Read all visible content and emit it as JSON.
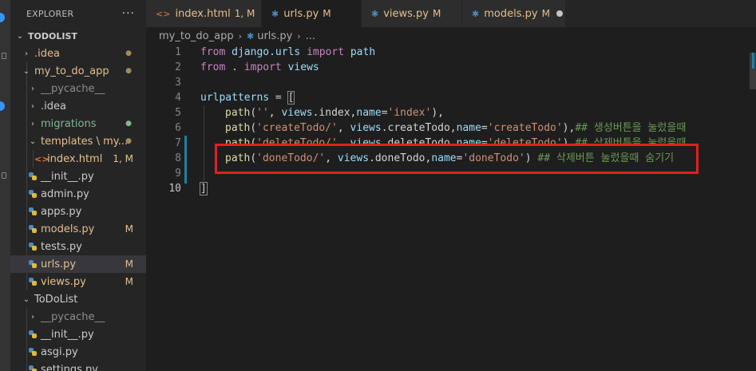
{
  "sidebar": {
    "title": "EXPLORER",
    "more": "···",
    "project": "TODOLIST",
    "items": [
      {
        "label": ".idea",
        "chev": "›",
        "color": "yellow",
        "badge": "●"
      },
      {
        "label": "my_to_do_app",
        "chev": "⌄",
        "color": "yellow",
        "badge": "●"
      },
      {
        "label": "__pycache__",
        "chev": "›",
        "color": "grey",
        "badge": ""
      },
      {
        "label": ".idea",
        "chev": "›",
        "color": "default",
        "badge": ""
      },
      {
        "label": "migrations",
        "chev": "›",
        "color": "green",
        "badge": "●"
      },
      {
        "label": "templates \\ my...",
        "chev": "⌄",
        "color": "yellow",
        "badge": "●"
      },
      {
        "label": "index.html",
        "chev": "",
        "color": "yellow",
        "badge": "1, M"
      },
      {
        "label": "__init__.py",
        "chev": "",
        "color": "default",
        "badge": ""
      },
      {
        "label": "admin.py",
        "chev": "",
        "color": "default",
        "badge": ""
      },
      {
        "label": "apps.py",
        "chev": "",
        "color": "default",
        "badge": ""
      },
      {
        "label": "models.py",
        "chev": "",
        "color": "yellow",
        "badge": "M"
      },
      {
        "label": "tests.py",
        "chev": "",
        "color": "default",
        "badge": ""
      },
      {
        "label": "urls.py",
        "chev": "",
        "color": "yellow",
        "badge": "M"
      },
      {
        "label": "views.py",
        "chev": "",
        "color": "yellow",
        "badge": "M"
      },
      {
        "label": "ToDoList",
        "chev": "⌄",
        "color": "default",
        "badge": ""
      },
      {
        "label": "__pycache__",
        "chev": "›",
        "color": "grey",
        "badge": ""
      },
      {
        "label": "__init__.py",
        "chev": "",
        "color": "default",
        "badge": ""
      },
      {
        "label": "asgi.py",
        "chev": "",
        "color": "default",
        "badge": ""
      },
      {
        "label": "settings.py",
        "chev": "",
        "color": "default",
        "badge": ""
      }
    ]
  },
  "tabs": [
    {
      "label": "index.html",
      "mod": "1, M",
      "icon": "html-icon"
    },
    {
      "label": "urls.py",
      "mod": "M",
      "icon": "python-icon"
    },
    {
      "label": "views.py",
      "mod": "M",
      "icon": "python-icon"
    },
    {
      "label": "models.py",
      "mod": "M",
      "icon": "python-icon"
    }
  ],
  "breadcrumb": {
    "folder": "my_to_do_app",
    "file": "urls.py",
    "more": "..."
  },
  "editor": {
    "line_numbers": [
      "1",
      "2",
      "3",
      "4",
      "5",
      "6",
      "7",
      "8",
      "9",
      "10"
    ],
    "line1": {
      "a": "from",
      "b": " django.urls ",
      "c": "import",
      "d": " path"
    },
    "line2": {
      "a": "from",
      "b": " . ",
      "c": "import",
      "d": " views"
    },
    "line4": {
      "a": "urlpatterns",
      "b": " = ",
      "c": "["
    },
    "line5": {
      "a": "path",
      "b": "(",
      "c": "''",
      "d": ", ",
      "e": "views",
      "f": ".index,",
      "g": "name",
      "h": "=",
      "i": "'index'",
      "j": "),"
    },
    "line6": {
      "a": "path",
      "b": "(",
      "c": "'createTodo/'",
      "d": ", ",
      "e": "views",
      "f": ".createTodo,",
      "g": "name",
      "h": "=",
      "i": "'createTodo'",
      "j": "),",
      "k": "## 생성버튼을 눌렀을때"
    },
    "line7": {
      "a": "path",
      "b": "(",
      "c": "'deleteTodo/'",
      "d": ", ",
      "e": "views",
      "f": ".deleteTodo,",
      "g": "name",
      "h": "=",
      "i": "'deleteTodo'",
      "j": "),",
      "k": "## 삭제버튼을 눌렀을때"
    },
    "line8": {
      "a": "path",
      "b": "(",
      "c": "'doneTodo/'",
      "d": ", ",
      "e": "views",
      "f": ".doneTodo,",
      "g": "name",
      "h": "=",
      "i": "'doneTodo'",
      "j": ")",
      "k": " ## 삭제버튼 눌렀을때 숨기기"
    },
    "line10": {
      "a": "]"
    }
  },
  "colors": {
    "highlight_box": "#e02020",
    "accent": "#3794ff"
  }
}
